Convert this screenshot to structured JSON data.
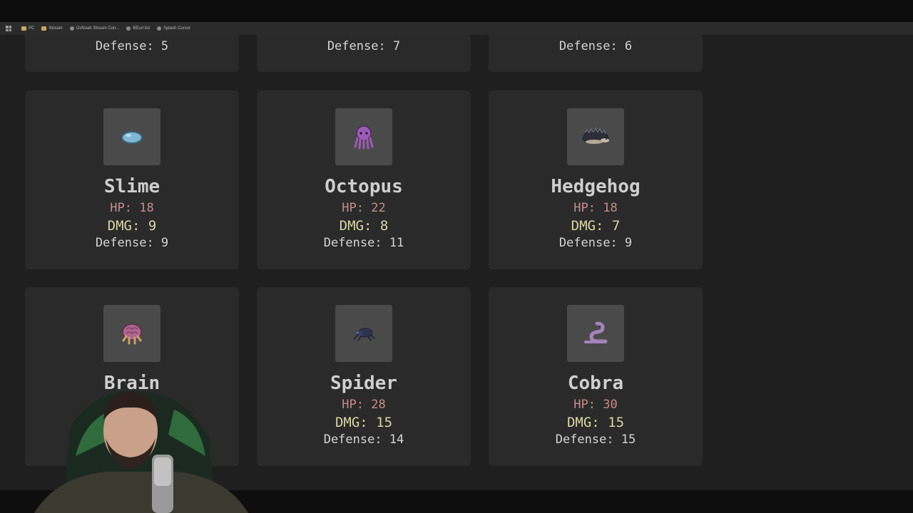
{
  "bookmarks": [
    {
      "label": "PC",
      "icon": "folder-icon"
    },
    {
      "label": "Stream",
      "icon": "folder-icon"
    },
    {
      "label": "OxNoah Stream Con...",
      "icon": "globe-icon"
    },
    {
      "label": "BEurl list",
      "icon": "globe-icon"
    },
    {
      "label": "Splash Cursor",
      "icon": "globe-icon"
    }
  ],
  "top_cards": [
    {
      "defense": "Defense: 5"
    },
    {
      "defense": "Defense: 7"
    },
    {
      "defense": "Defense: 6"
    }
  ],
  "cards": [
    {
      "name": "Slime",
      "hp": "HP: 18",
      "dmg": "DMG: 9",
      "defense": "Defense: 9",
      "icon": "slime-icon"
    },
    {
      "name": "Octopus",
      "hp": "HP: 22",
      "dmg": "DMG: 8",
      "defense": "Defense: 11",
      "icon": "octopus-icon"
    },
    {
      "name": "Hedgehog",
      "hp": "HP: 18",
      "dmg": "DMG: 7",
      "defense": "Defense: 9",
      "icon": "hedgehog-icon"
    },
    {
      "name": "Brain",
      "hp": "",
      "dmg": "",
      "defense": "",
      "icon": "brain-icon"
    },
    {
      "name": "Spider",
      "hp": "HP: 28",
      "dmg": "DMG: 15",
      "defense": "Defense: 14",
      "icon": "spider-icon"
    },
    {
      "name": "Cobra",
      "hp": "HP: 30",
      "dmg": "DMG: 15",
      "defense": "Defense: 15",
      "icon": "cobra-icon"
    }
  ],
  "colors": {
    "page_bg": "#1f1f1f",
    "card_bg": "#2a2a2a",
    "thumb_bg": "#4a4a4a",
    "hp": "#c98b8b",
    "dmg": "#d8d4a8",
    "text": "#d4d4d4"
  }
}
